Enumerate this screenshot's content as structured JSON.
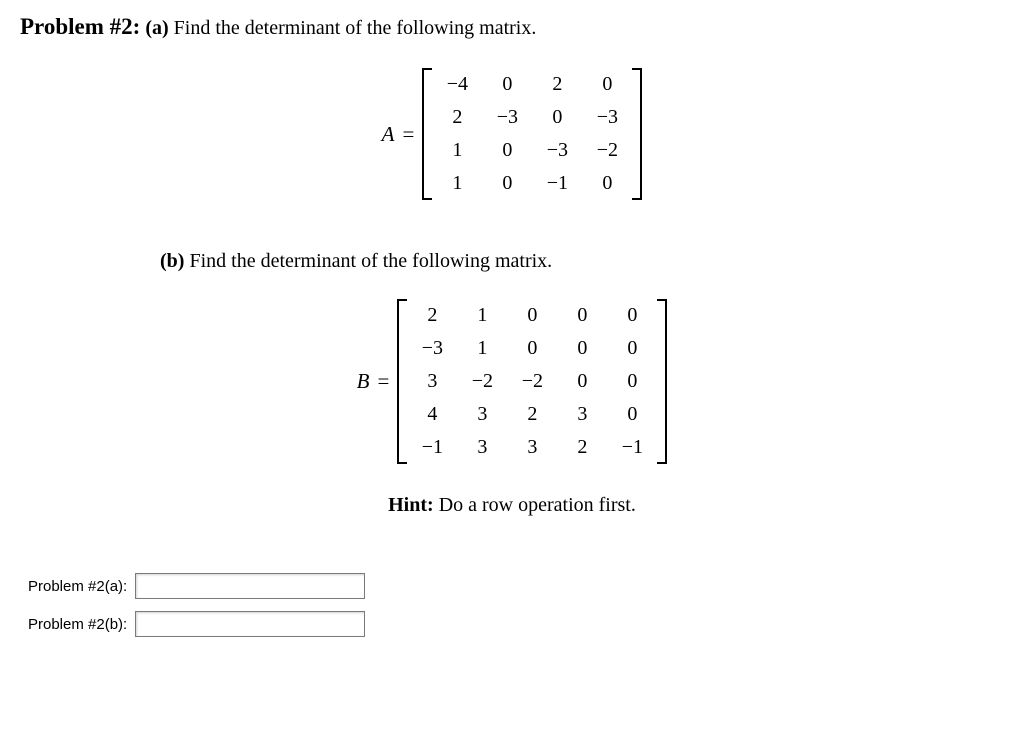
{
  "heading": {
    "problem_label": "Problem #2:",
    "part_a_label": "(a)",
    "part_a_stem": "Find the determinant of the following matrix."
  },
  "matrixA": {
    "name": "A",
    "eq": "=",
    "rows": [
      [
        "−4",
        "0",
        "2",
        "0"
      ],
      [
        "2",
        "−3",
        "0",
        "−3"
      ],
      [
        "1",
        "0",
        "−3",
        "−2"
      ],
      [
        "1",
        "0",
        "−1",
        "0"
      ]
    ]
  },
  "partB": {
    "label": "(b)",
    "stem": "Find the determinant of the following matrix."
  },
  "matrixB": {
    "name": "B",
    "eq": "=",
    "rows": [
      [
        "2",
        "1",
        "0",
        "0",
        "0"
      ],
      [
        "−3",
        "1",
        "0",
        "0",
        "0"
      ],
      [
        "3",
        "−2",
        "−2",
        "0",
        "0"
      ],
      [
        "4",
        "3",
        "2",
        "3",
        "0"
      ],
      [
        "−1",
        "3",
        "3",
        "2",
        "−1"
      ]
    ]
  },
  "hint": {
    "label": "Hint:",
    "text": "Do a row operation first."
  },
  "answers": {
    "a_label": "Problem #2(a):",
    "a_value": "",
    "b_label": "Problem #2(b):",
    "b_value": ""
  }
}
